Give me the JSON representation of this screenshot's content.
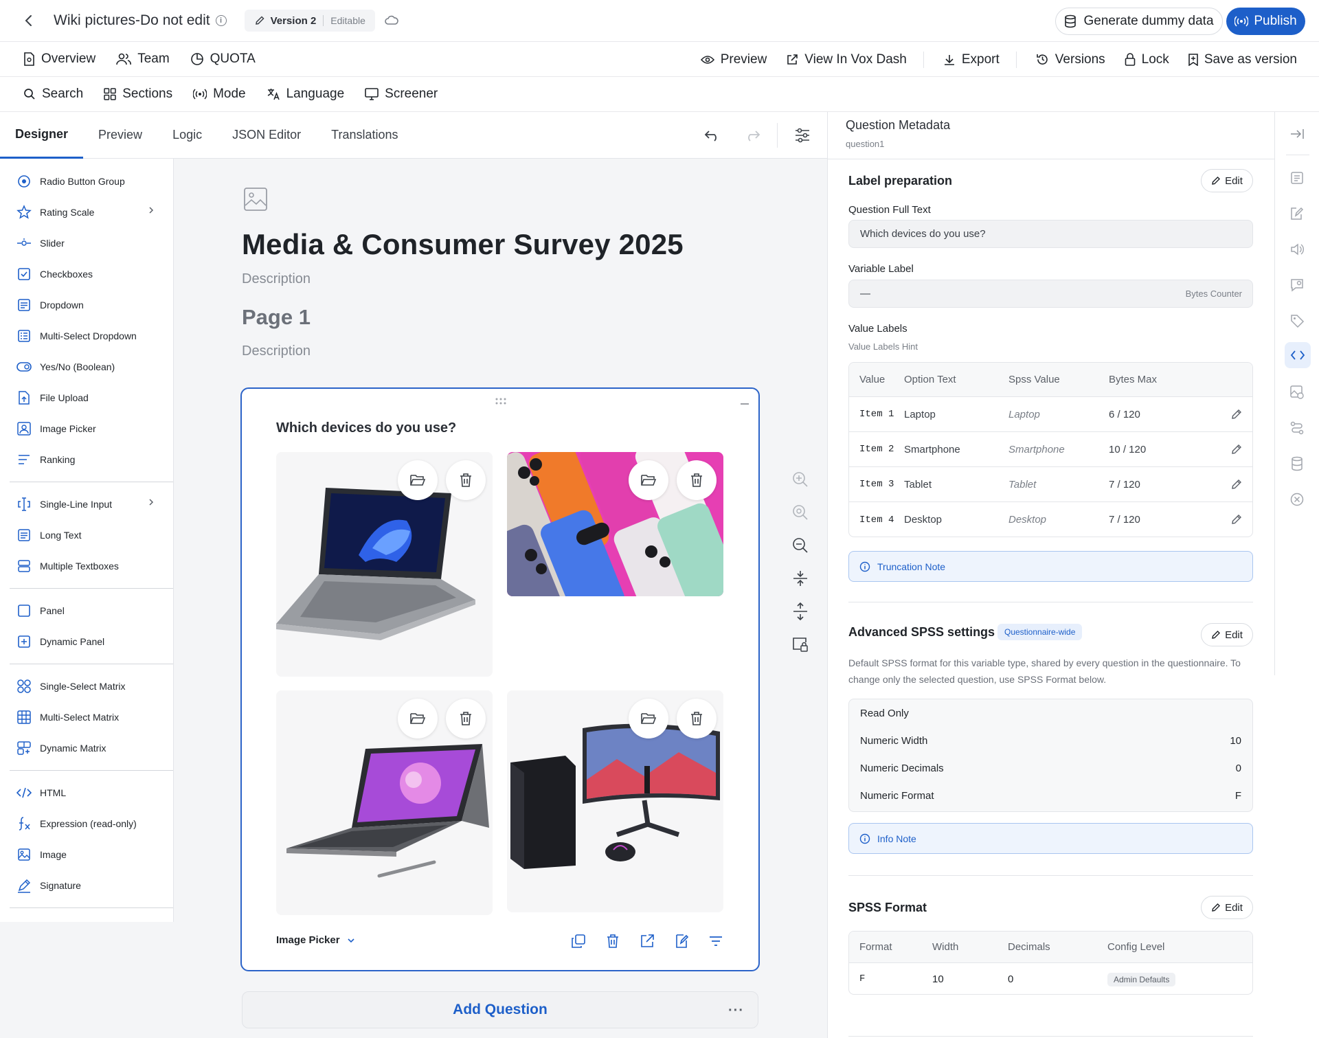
{
  "header": {
    "title": "Wiki pictures-Do not edit",
    "version": "Version 2",
    "status": "Editable",
    "generate_label": "Generate dummy data",
    "publish_label": "Publish"
  },
  "nav_bar": {
    "left": [
      "Overview",
      "Team",
      "QUOTA"
    ],
    "right": [
      "Preview",
      "View In Vox Dash",
      "Export",
      "Versions",
      "Lock",
      "Save as version"
    ]
  },
  "tool_bar": [
    "Search",
    "Sections",
    "Mode",
    "Language",
    "Screener"
  ],
  "tabs": [
    "Designer",
    "Preview",
    "Logic",
    "JSON Editor",
    "Translations"
  ],
  "toolbox": {
    "group1": [
      "Radio Button Group",
      "Rating Scale",
      "Slider",
      "Checkboxes",
      "Dropdown",
      "Multi-Select Dropdown",
      "Yes/No (Boolean)",
      "File Upload",
      "Image Picker",
      "Ranking"
    ],
    "group2": [
      "Single-Line Input",
      "Long Text",
      "Multiple Textboxes"
    ],
    "group3": [
      "Panel",
      "Dynamic Panel"
    ],
    "group4": [
      "Single-Select Matrix",
      "Multi-Select Matrix",
      "Dynamic Matrix"
    ],
    "group5": [
      "HTML",
      "Expression (read-only)",
      "Image",
      "Signature"
    ]
  },
  "survey": {
    "title": "Media & Consumer Survey 2025",
    "description": "Description",
    "page_title": "Page 1",
    "page_description": "Description",
    "question_title": "Which devices do you use?",
    "question_type": "Image Picker",
    "add_question": "Add Question"
  },
  "metadata": {
    "heading": "Question Metadata",
    "question_id": "question1",
    "label_prep": "Label preparation",
    "edit": "Edit",
    "full_text_label": "Question Full Text",
    "full_text_value": "Which devices do you use?",
    "variable_label": "Variable Label",
    "variable_value": "—",
    "bytes_counter": "Bytes Counter",
    "value_labels": "Value Labels",
    "value_labels_hint": "Value Labels Hint",
    "value_headers": [
      "Value",
      "Option Text",
      "Spss Value",
      "Bytes Max"
    ],
    "value_rows": [
      {
        "value": "Item 1",
        "text": "Laptop",
        "spss": "Laptop",
        "bytes": "6 / 120"
      },
      {
        "value": "Item 2",
        "text": "Smartphone",
        "spss": "Smartphone",
        "bytes": "10 / 120"
      },
      {
        "value": "Item 3",
        "text": "Tablet",
        "spss": "Tablet",
        "bytes": "7 / 120"
      },
      {
        "value": "Item 4",
        "text": "Desktop",
        "spss": "Desktop",
        "bytes": "7 / 120"
      }
    ],
    "truncation_note": "Truncation Note",
    "advanced_title": "Advanced SPSS settings",
    "advanced_badge": "Questionnaire-wide",
    "advanced_desc": "Default SPSS format for this variable type, shared by every question in the questionnaire. To change only the selected question, use SPSS Format below.",
    "settings": [
      {
        "label": "Read Only",
        "value": ""
      },
      {
        "label": "Numeric Width",
        "value": "10"
      },
      {
        "label": "Numeric Decimals",
        "value": "0"
      },
      {
        "label": "Numeric Format",
        "value": "F"
      }
    ],
    "info_note": "Info Note",
    "spss_format_title": "SPSS Format",
    "format_headers": [
      "Format",
      "Width",
      "Decimals",
      "Config Level"
    ],
    "format_row": {
      "format": "F",
      "width": "10",
      "decimals": "0",
      "config": "Admin Defaults"
    }
  },
  "colors": {
    "accent": "#1d5fc9",
    "note_bg": "#eef4fd"
  }
}
